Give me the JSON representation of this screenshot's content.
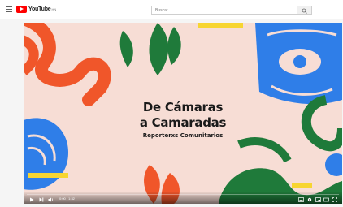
{
  "header": {
    "logo_text": "YouTube",
    "logo_sup": "HN",
    "search_placeholder": "Buscar"
  },
  "video": {
    "title_line1": "De Cámaras",
    "title_line2": "a Camaradas",
    "subtitle": "Reporterxs Comunitarios"
  },
  "player": {
    "time": "0:00 / 1:32",
    "progress": 0
  }
}
